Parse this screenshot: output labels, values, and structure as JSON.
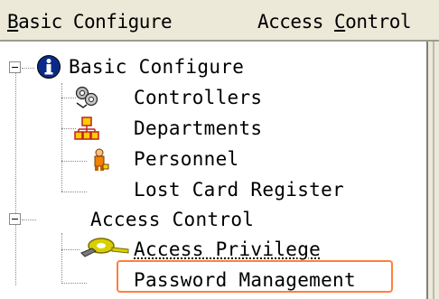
{
  "menubar": {
    "items": [
      {
        "label_underlined": "B",
        "label_rest": "asic Configure"
      },
      {
        "label_start": "Access ",
        "label_underlined": "C",
        "label_rest": "ontrol"
      }
    ]
  },
  "tree": {
    "root_basic": {
      "label": "Basic Configure",
      "icon": "info-icon",
      "expanded": true
    },
    "controllers": {
      "label": "Controllers",
      "icon": "controllers-icon"
    },
    "departments": {
      "label": "Departments",
      "icon": "departments-icon"
    },
    "personnel": {
      "label": "Personnel",
      "icon": "person-icon"
    },
    "lost_card": {
      "label": "Lost Card Register"
    },
    "root_access": {
      "label": "Access Control",
      "expanded": true
    },
    "access_privilege": {
      "label": "Access Privilege",
      "icon": "key-icon"
    },
    "password_management": {
      "label": "Password Management",
      "highlighted": true
    }
  },
  "colors": {
    "menubar_bg": "#ece9d8",
    "highlight_border": "#ff7f3f"
  }
}
